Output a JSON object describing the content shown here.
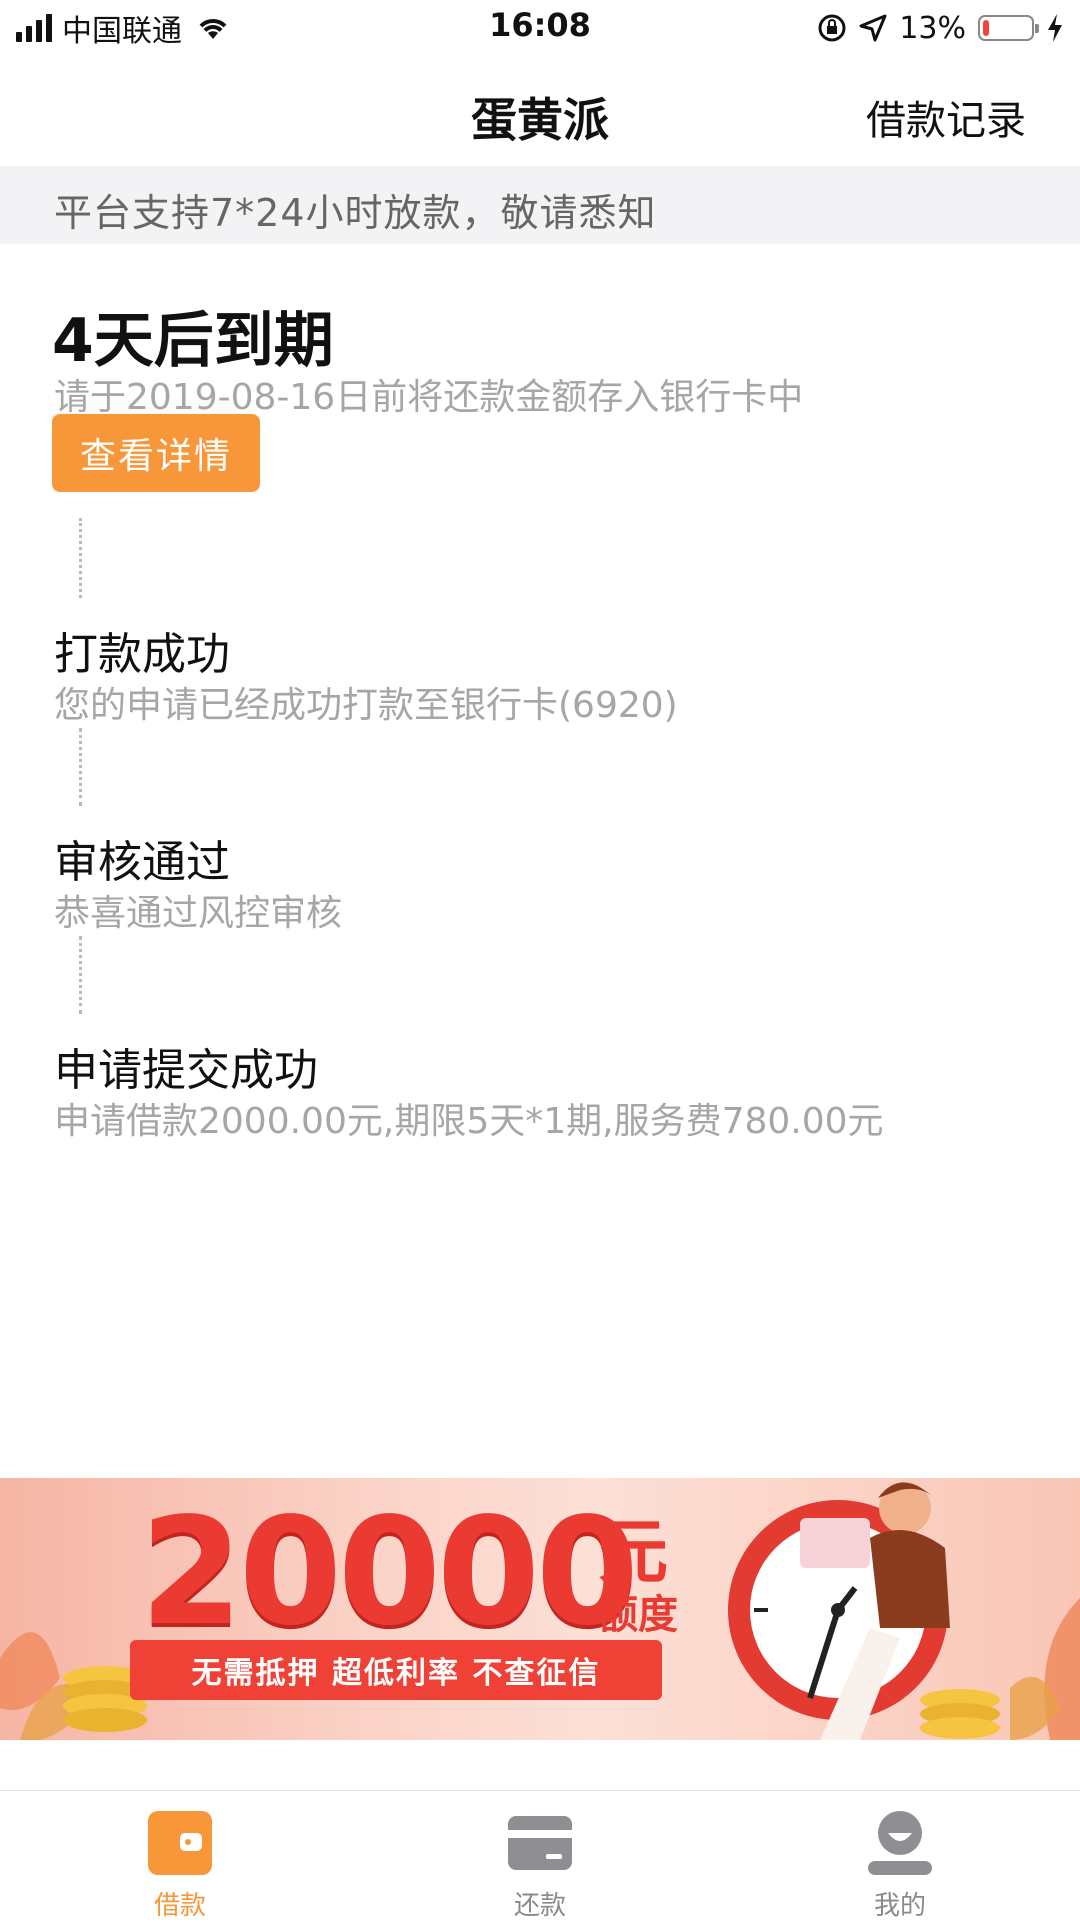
{
  "status_bar": {
    "carrier": "中国联通",
    "time": "16:08",
    "battery_pct": "13%",
    "battery_level": 0.13
  },
  "nav": {
    "title": "蛋黄派",
    "right_link": "借款记录"
  },
  "notice": "平台支持7*24小时放款，敬请悉知",
  "due": {
    "title": "4天后到期",
    "desc": "请于2019-08-16日前将还款金额存入银行卡中",
    "button": "查看详情"
  },
  "steps": [
    {
      "title": "打款成功",
      "desc": "您的申请已经成功打款至银行卡(6920)"
    },
    {
      "title": "审核通过",
      "desc": "恭喜通过风控审核"
    },
    {
      "title": "申请提交成功",
      "desc": "申请借款2000.00元,期限5天*1期,服务费780.00元"
    }
  ],
  "banner": {
    "amount": "20000",
    "unit": "元",
    "quota": "额度",
    "tagline": "无需抵押  超低利率  不查征信"
  },
  "tabs": [
    {
      "label": "借款",
      "icon": "wallet-icon",
      "active": true
    },
    {
      "label": "还款",
      "icon": "card-icon",
      "active": false
    },
    {
      "label": "我的",
      "icon": "user-icon",
      "active": false
    }
  ],
  "colors": {
    "accent": "#f7973a",
    "banner_red": "#ea3a31",
    "inactive_icon": "#8e8e93"
  }
}
